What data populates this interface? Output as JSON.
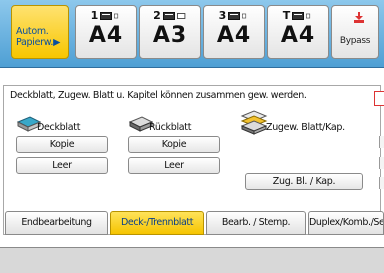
{
  "trays": {
    "auto": {
      "label_line1": "Autom.",
      "label_line2": "Papierw.",
      "arrow": "▶"
    },
    "items": [
      {
        "number": "1",
        "size": "A4"
      },
      {
        "number": "2",
        "size": "A3"
      },
      {
        "number": "3",
        "size": "A4"
      },
      {
        "number": "T",
        "size": "A4"
      }
    ],
    "bypass": {
      "label": "Bypass"
    }
  },
  "message": "Deckblatt, Zugew. Blatt u. Kapitel können zusammen gew. werden.",
  "groups": {
    "front": {
      "title": "Deckblatt",
      "btn1": "Kopie",
      "btn2": "Leer"
    },
    "back": {
      "title": "Rückblatt",
      "btn1": "Kopie",
      "btn2": "Leer"
    },
    "designate": {
      "title": "Zugew. Blatt/Kap.",
      "btn": "Zug. Bl. / Kap."
    }
  },
  "tabs": [
    "Endbearbeitung",
    "Deck-/Trennblatt",
    "Bearb. / Stemp.",
    "Duplex/Komb./Seri"
  ],
  "active_tab_index": 1,
  "colors": {
    "tray_strip": "#4e9fd4",
    "auto_tray": "#f7c600",
    "active_tab": "#f5c400",
    "label_blue": "#0a4f9e"
  }
}
